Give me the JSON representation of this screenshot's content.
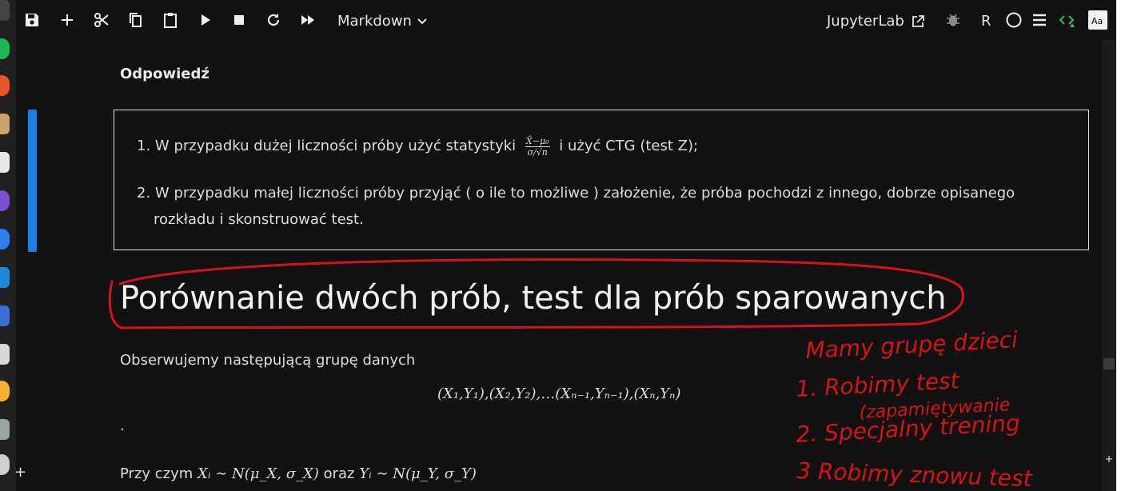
{
  "toolbar": {
    "cell_type": "Markdown",
    "jupyterlab_label": "JupyterLab",
    "kernel": "R"
  },
  "notebook": {
    "answer_heading": "Odpowiedź",
    "answers": [
      {
        "number": "1.",
        "text_before": "W przypadku dużej liczności próby użyć statystyki",
        "formula_num": "X̄−μ₀",
        "formula_den": "σ/√n",
        "text_after": "i użyć CTG (test Z);"
      },
      {
        "number": "2.",
        "line1": "W przypadku małej liczności próby przyjąć ( o ile to możliwe ) założenie, że próba pochodzi z innego, dobrze opisanego",
        "line2": "rozkładu i skonstruować test."
      }
    ],
    "section_title": "Porównanie dwóch prób, test dla prób sparowanych",
    "intro": "Obserwujemy następującą grupę danych",
    "data_formula": "(X₁,Y₁),(X₂,Y₂),…(Xₙ₋₁,Yₙ₋₁),(Xₙ,Yₙ)",
    "dot": ".",
    "condition_prefix": "Przy czym",
    "condition_x": "Xᵢ ∼ N(μ_X, σ_X)",
    "condition_mid": "oraz",
    "condition_y": "Yᵢ ∼ N(μ_Y, σ_Y)"
  },
  "annotations": {
    "handwriting": [
      "Mamy grupę dzieci",
      "1. Robimy test",
      "(zapamiętywanie",
      "2. Specjalny trening",
      "3 Robimy znowu test"
    ],
    "ink_color": "#d41414"
  },
  "dock": {
    "add_label": "+"
  }
}
